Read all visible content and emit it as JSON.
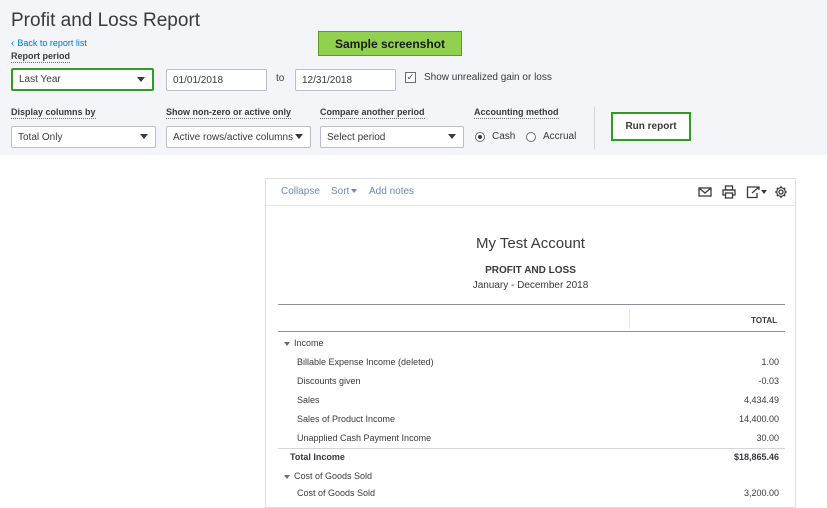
{
  "page": {
    "title": "Profit and Loss Report",
    "back_link": "Back to report list",
    "sample_banner": "Sample screenshot"
  },
  "filters": {
    "report_period_label": "Report period",
    "report_period_value": "Last Year",
    "start_date": "01/01/2018",
    "to_label": "to",
    "end_date": "12/31/2018",
    "unrealized_label": "Show unrealized gain or loss",
    "unrealized_checked": true,
    "display_columns_label": "Display columns by",
    "display_columns_value": "Total Only",
    "show_nonzero_label": "Show non-zero or active only",
    "show_nonzero_value": "Active rows/active columns",
    "compare_label": "Compare another period",
    "compare_value": "Select period",
    "accounting_label": "Accounting method",
    "cash_label": "Cash",
    "accrual_label": "Accrual",
    "accounting_selected": "Cash",
    "run_button": "Run report"
  },
  "toolbar": {
    "collapse": "Collapse",
    "sort": "Sort",
    "add_notes": "Add notes",
    "icons": [
      "email-icon",
      "print-icon",
      "export-icon",
      "settings-icon"
    ]
  },
  "report": {
    "company": "My Test Account",
    "title": "PROFIT AND LOSS",
    "dates": "January - December 2018",
    "column_header": "TOTAL",
    "rows": [
      {
        "name": "Income",
        "value": "",
        "indent": 0,
        "section": true
      },
      {
        "name": "Billable Expense Income (deleted)",
        "value": "1.00",
        "indent": 1
      },
      {
        "name": "Discounts given",
        "value": "-0.03",
        "indent": 1
      },
      {
        "name": "Sales",
        "value": "4,434.49",
        "indent": 1
      },
      {
        "name": "Sales of Product Income",
        "value": "14,400.00",
        "indent": 1
      },
      {
        "name": "Unapplied Cash Payment Income",
        "value": "30.00",
        "indent": 1
      },
      {
        "name": "Total Income",
        "value": "$18,865.46",
        "indent": 0,
        "bold": true
      },
      {
        "name": "Cost of Goods Sold",
        "value": "",
        "indent": 0,
        "section": true
      },
      {
        "name": "Cost of Goods Sold",
        "value": "3,200.00",
        "indent": 1
      }
    ]
  },
  "colors": {
    "accent_green": "#2ca01c",
    "link_blue": "#0077c5",
    "banner_green": "#92d050"
  }
}
